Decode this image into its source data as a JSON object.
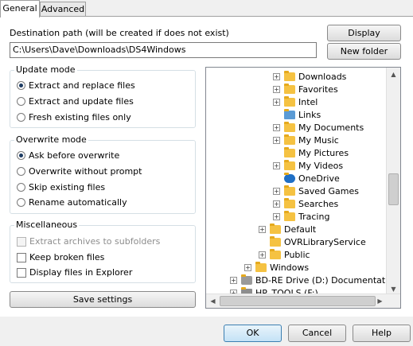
{
  "tabs": [
    {
      "label": "General"
    },
    {
      "label": "Advanced"
    }
  ],
  "destination": {
    "label": "Destination path (will be created if does not exist)",
    "value": "C:\\Users\\Dave\\Downloads\\DS4Windows",
    "display_label": "Display",
    "new_folder_label": "New folder"
  },
  "update_mode": {
    "title": "Update mode",
    "options": [
      "Extract and replace files",
      "Extract and update files",
      "Fresh existing files only"
    ],
    "selected": 0
  },
  "overwrite_mode": {
    "title": "Overwrite mode",
    "options": [
      "Ask before overwrite",
      "Overwrite without prompt",
      "Skip existing files",
      "Rename automatically"
    ],
    "selected": 0
  },
  "misc": {
    "title": "Miscellaneous",
    "options": [
      {
        "label": "Extract archives to subfolders",
        "checked": false,
        "disabled": true
      },
      {
        "label": "Keep broken files",
        "checked": false,
        "disabled": false
      },
      {
        "label": "Display files in Explorer",
        "checked": false,
        "disabled": false
      }
    ]
  },
  "save_settings_label": "Save settings",
  "tree": {
    "items": [
      {
        "label": "Downloads",
        "icon": "downloads-folder-icon"
      },
      {
        "label": "Favorites",
        "icon": "favorites-folder-icon"
      },
      {
        "label": "Intel",
        "icon": "folder-icon"
      },
      {
        "label": "Links",
        "icon": "links-folder-icon"
      },
      {
        "label": "My Documents",
        "icon": "documents-folder-icon"
      },
      {
        "label": "My Music",
        "icon": "music-folder-icon"
      },
      {
        "label": "My Pictures",
        "icon": "pictures-folder-icon"
      },
      {
        "label": "My Videos",
        "icon": "videos-folder-icon"
      },
      {
        "label": "OneDrive",
        "icon": "onedrive-cloud-icon"
      },
      {
        "label": "Saved Games",
        "icon": "folder-icon"
      },
      {
        "label": "Searches",
        "icon": "search-folder-icon"
      },
      {
        "label": "Tracing",
        "icon": "folder-icon"
      },
      {
        "label": "Default",
        "icon": "folder-icon"
      },
      {
        "label": "OVRLibraryService",
        "icon": "folder-icon"
      },
      {
        "label": "Public",
        "icon": "folder-icon"
      },
      {
        "label": "Windows",
        "icon": "folder-icon"
      },
      {
        "label": "BD-RE Drive (D:) Documentation C",
        "icon": "optical-drive-icon"
      },
      {
        "label": "HP_TOOLS (F:)",
        "icon": "drive-icon"
      }
    ]
  },
  "footer": {
    "ok": "OK",
    "cancel": "Cancel",
    "help": "Help"
  }
}
